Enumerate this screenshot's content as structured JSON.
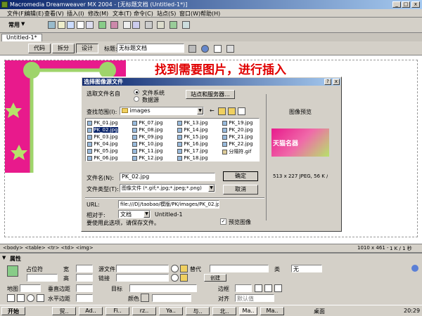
{
  "app": {
    "title": "Macromedia Dreamweaver MX 2004 - [无标题文档 (Untitled-1*)]",
    "menu": [
      "文件(F)",
      "编辑(E)",
      "查看(V)",
      "插入(I)",
      "修改(M)",
      "文本(T)",
      "命令(C)",
      "站点(S)",
      "窗口(W)",
      "帮助(H)"
    ],
    "insert_category": "常用"
  },
  "document": {
    "tab": "Untitled-1*",
    "view_buttons": [
      "代码",
      "拆分",
      "设计"
    ],
    "title_label": "标题:",
    "title_value": "无标题文档",
    "annotation": "找到需要图片，进行插入",
    "tag_selector": "<body> <table> <tr> <td> <img>",
    "status_size": "1010 x 461 -",
    "status_kb": "1 K / 1 秒"
  },
  "dialog": {
    "title": "选择图像源文件",
    "help_btn": "?",
    "close_btn": "x",
    "select_from_label": "选取文件名自",
    "radio_filesystem": "文件系统",
    "radio_datasource": "数据源",
    "site_server_btn": "站点和服务器...",
    "lookin_label": "查找范围(I):",
    "lookin_value": "images",
    "files": [
      [
        "PK_01.jpg",
        "PK_07.jpg",
        "PK_13.jpg",
        "PK_19.jpg"
      ],
      [
        "PK_02.jpg",
        "PK_08.jpg",
        "PK_14.jpg",
        "PK_20.jpg"
      ],
      [
        "PK_03.jpg",
        "PK_09.jpg",
        "PK_15.jpg",
        "PK_21.jpg"
      ],
      [
        "PK_04.jpg",
        "PK_10.jpg",
        "PK_16.jpg",
        "PK_22.jpg"
      ],
      [
        "PK_05.jpg",
        "PK_11.jpg",
        "PK_17.jpg",
        "分隔符.gif"
      ],
      [
        "PK_06.jpg",
        "PK_12.jpg",
        "PK_18.jpg",
        ""
      ]
    ],
    "filename_label": "文件名(N):",
    "filename_value": "PK_02.jpg",
    "filetype_label": "文件类型(T):",
    "filetype_value": "图像文件 (*.gif;*.jpg;*.jpeg;*.png)",
    "ok_btn": "确定",
    "cancel_btn": "取消",
    "url_label": "URL:",
    "url_value": "file:///D|/taobao/模版/PK/images/PK_02.jp",
    "relative_label": "相对于:",
    "relative_value": "文档",
    "relative_doc": "Untitled-1",
    "save_note": "要使用此选项，请保存文件。",
    "preview_label": "图像预览",
    "preview_check": "预览图像",
    "preview_info": "513 x 227 JPEG, 56 K /",
    "preview_thumb_text": "天猫名器"
  },
  "properties": {
    "header": "属性",
    "placeholder_label": "占位符",
    "width_label": "宽",
    "height_label": "高",
    "src_label": "源文件",
    "link_label": "链接",
    "alt_label": "替代",
    "class_label": "类",
    "class_value": "无",
    "create_btn": "创建",
    "map_label": "地图",
    "vspace_label": "垂直边距",
    "target_label": "目标",
    "border_label": "边框",
    "hspace_label": "水平边距",
    "color_label": "颜色",
    "align_label": "对齐",
    "align_value": "默认值"
  },
  "taskbar": {
    "start": "开始",
    "tasks": [
      "贸..",
      "Ad..",
      "Fi..",
      "rz..",
      "Ya..",
      "与..",
      "北..",
      "Ma..",
      "Ma.."
    ],
    "desktop": "桌面",
    "clock": "20:29"
  },
  "colors": {
    "titlebar": "#0a246a",
    "dialog_title": "#0a246a",
    "selection": "#0a246a",
    "banner_pink": "#e81a8c",
    "annotation_red": "#e00000"
  }
}
